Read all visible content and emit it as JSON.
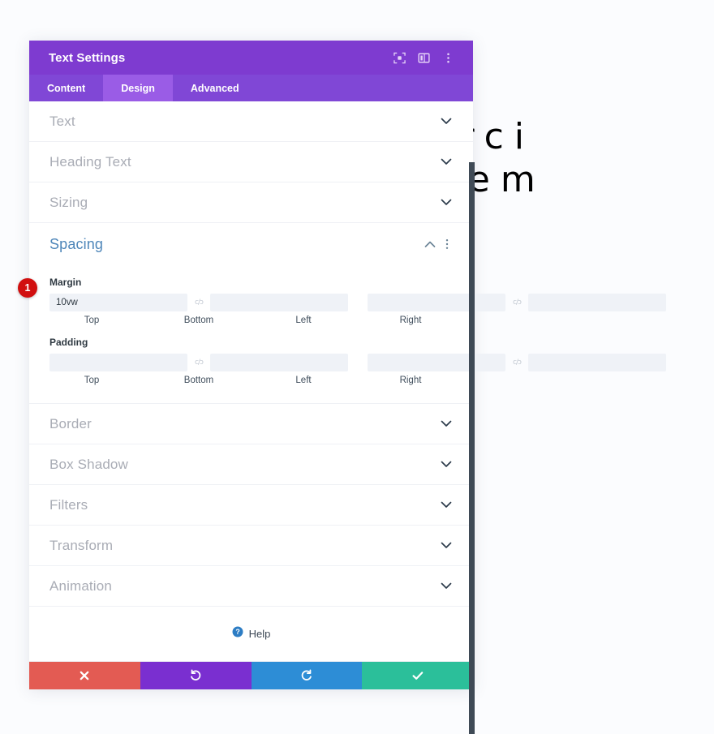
{
  "canvas": {
    "line1": "d Exerci",
    "line2": "ritatem"
  },
  "panel": {
    "title": "Text Settings",
    "header_icons": [
      {
        "name": "focus-target-icon",
        "label": "Focus"
      },
      {
        "name": "layout-panel-icon",
        "label": "Panel Layout"
      },
      {
        "name": "more-vertical-icon",
        "label": "More Options"
      }
    ],
    "tabs": [
      {
        "label": "Content",
        "active": false
      },
      {
        "label": "Design",
        "active": true
      },
      {
        "label": "Advanced",
        "active": false
      }
    ],
    "sections": [
      {
        "label": "Text",
        "open": false
      },
      {
        "label": "Heading Text",
        "open": false
      },
      {
        "label": "Sizing",
        "open": false
      },
      {
        "label": "Spacing",
        "open": true
      },
      {
        "label": "Border",
        "open": false
      },
      {
        "label": "Box Shadow",
        "open": false
      },
      {
        "label": "Filters",
        "open": false
      },
      {
        "label": "Transform",
        "open": false
      },
      {
        "label": "Animation",
        "open": false
      }
    ],
    "spacing": {
      "margin": {
        "label": "Margin",
        "badge": "1",
        "link_icon": "c/ɔ",
        "fields": [
          {
            "caption": "Top",
            "value": "10vw",
            "placeholder": ""
          },
          {
            "caption": "Bottom",
            "value": "",
            "placeholder": ""
          },
          {
            "caption": "Left",
            "value": "",
            "placeholder": ""
          },
          {
            "caption": "Right",
            "value": "",
            "placeholder": ""
          }
        ]
      },
      "padding": {
        "label": "Padding",
        "link_icon": "c/ɔ",
        "fields": [
          {
            "caption": "Top",
            "value": "",
            "placeholder": ""
          },
          {
            "caption": "Bottom",
            "value": "",
            "placeholder": ""
          },
          {
            "caption": "Left",
            "value": "",
            "placeholder": ""
          },
          {
            "caption": "Right",
            "value": "",
            "placeholder": ""
          }
        ]
      }
    },
    "help": {
      "label": "Help",
      "icon": "question-circle-icon"
    },
    "footer": [
      {
        "name": "cancel-button",
        "icon": "close-icon",
        "color": "#e35b53"
      },
      {
        "name": "undo-button",
        "icon": "undo-icon",
        "color": "#7a2fd0"
      },
      {
        "name": "redo-button",
        "icon": "redo-icon",
        "color": "#2d8dd6"
      },
      {
        "name": "save-button",
        "icon": "check-icon",
        "color": "#2bbf9a"
      }
    ]
  },
  "colors": {
    "header_purple": "#7e3bd0",
    "tabbar_purple": "#8047d6",
    "active_tab_purple": "#9a5ce6",
    "badge_red": "#d10f0f",
    "open_section_blue": "#4e86b9",
    "page_background": "#fbfcfe"
  }
}
